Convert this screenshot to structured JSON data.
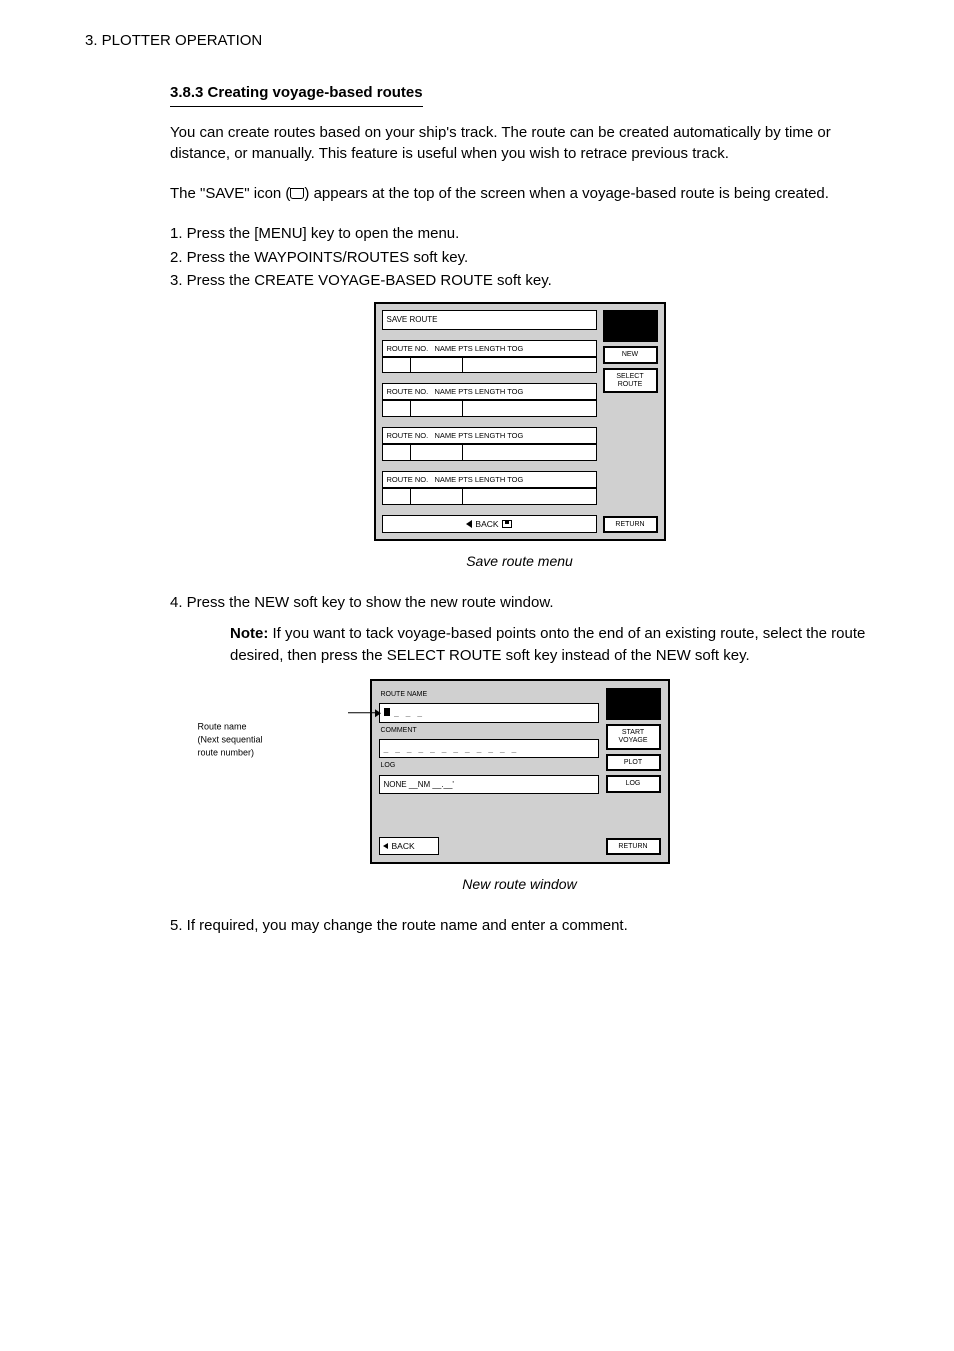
{
  "header": "3. PLOTTER OPERATION",
  "heading": "3.8.3 Creating voyage-based routes",
  "para1": "You can create routes based on your ship's track. The route can be created automatically by time or distance, or manually. This feature is useful when you wish to retrace previous track.",
  "para2_a": "The \"SAVE\" icon (",
  "para2_b": ") appears at the top of the screen when a voyage-based route is being created.",
  "steps": {
    "s1": "1.  Press the [MENU] key to open the menu.",
    "s2": "2.  Press the WAYPOINTS/ROUTES soft key.",
    "s3": "3.  Press the CREATE VOYAGE-BASED ROUTE soft key."
  },
  "screen1": {
    "title": "SAVE ROUTE",
    "route_no_label": "ROUTE NO.",
    "route_no_labels": "NAME    PTS   LENGTH  TOG",
    "softkeys": {
      "new": "NEW",
      "select_route": "SELECT\nROUTE",
      "return": "RETURN"
    },
    "back": "BACK",
    "caption": "Save route menu"
  },
  "step4": "4.  Press the NEW soft key to show the new route window.",
  "note_label": "Note:",
  "note_text": " If you want to tack voyage-based points onto the end of an existing route, select the route desired, then press the SELECT ROUTE soft key instead of the NEW soft key.",
  "screen2": {
    "route_label": "ROUTE NAME",
    "comment_label": "COMMENT",
    "log_label": "LOG",
    "log_row": "NONE  __NM  __.__'",
    "arrow_caption": "Route name\n(Next sequential\nroute number)",
    "softkeys": {
      "start": "START\nVOYAGE",
      "plot": "PLOT",
      "log": "LOG",
      "return": "RETURN"
    },
    "back": "BACK",
    "caption": "New route window"
  },
  "step5": "5.  If required, you may change the route name and enter a comment."
}
